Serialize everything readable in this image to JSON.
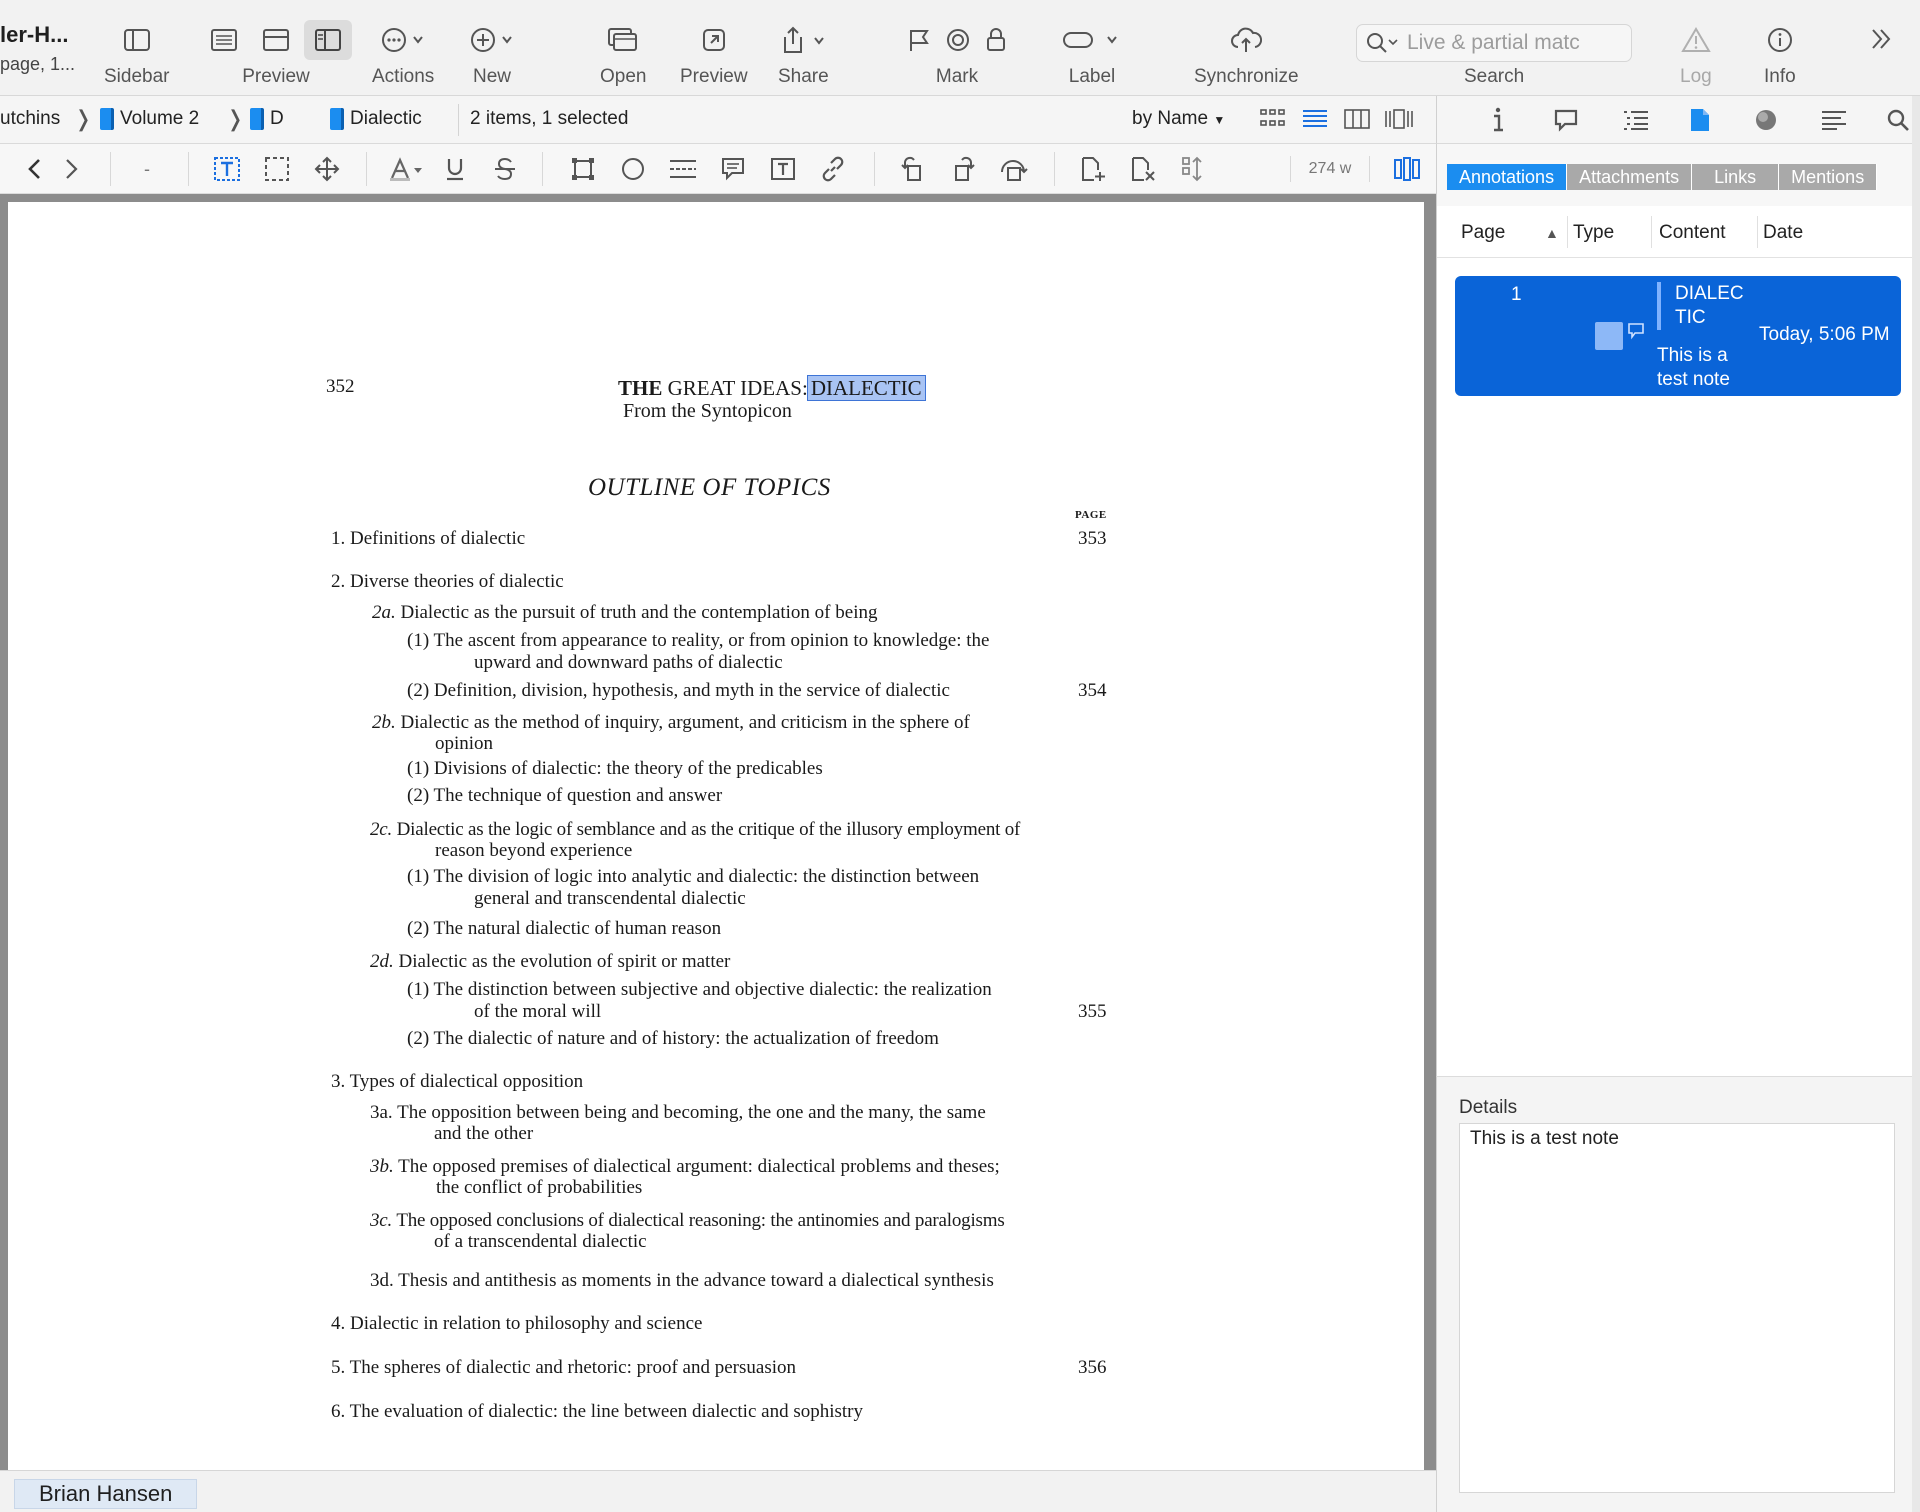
{
  "window": {
    "title": "ler-H...",
    "subtitle": "page, 1..."
  },
  "toolbar": {
    "sidebar": "Sidebar",
    "preview": "Preview",
    "actions": "Actions",
    "new": "New",
    "open": "Open",
    "preview2": "Preview",
    "share": "Share",
    "mark": "Mark",
    "label": "Label",
    "synchronize": "Synchronize",
    "search": "Search",
    "search_placeholder": "Live & partial matc",
    "log": "Log",
    "info": "Info"
  },
  "pathbar": {
    "crumbs": [
      "utchins",
      "Volume 2",
      "D"
    ],
    "current_group": "Dialectic",
    "status": "2 items, 1 selected",
    "sort": "by Name"
  },
  "edit_toolbar": {
    "zoom_hint": "-",
    "word_count": "274 w"
  },
  "inspector": {
    "tabs": [
      "Annotations",
      "Attachments",
      "Links",
      "Mentions"
    ],
    "active_tab": "Annotations",
    "columns": [
      "Page",
      "Type",
      "Content",
      "Date"
    ],
    "rows": [
      {
        "page": "1",
        "content_highlight": "DIALECTIC",
        "content_note": "This is a test note",
        "date": "Today, 5:06 PM"
      }
    ],
    "details_label": "Details",
    "details_text": "This is a test note"
  },
  "document": {
    "page_number": "352",
    "title_bold": "THE",
    "title_rest": "GREAT IDEAS:",
    "title_highlight": "DIALECTIC",
    "subtitle": "From the Syntopicon",
    "outline_heading": "OUTLINE OF TOPICS",
    "page_column_label": "PAGE",
    "topics": {
      "t1": "1. Definitions of dialectic",
      "t2": "2. Diverse theories of dialectic",
      "t2a_num": "2a.",
      "t2a": "Dialectic as the pursuit of truth and the contemplation of being",
      "t2a1a": "(1) The ascent from appearance to reality, or from opinion to knowledge: the",
      "t2a1b": "upward and downward paths of dialectic",
      "t2a2": "(2) Definition, division, hypothesis, and myth in the service of dialectic",
      "t2b_num": "2b.",
      "t2b_a": "Dialectic as the method of inquiry, argument, and criticism in the sphere of",
      "t2b_b": "opinion",
      "t2b1": "(1) Divisions of dialectic: the theory of the predicables",
      "t2b2": "(2) The technique of question and answer",
      "t2c_num": "2c.",
      "t2c_a": "Dialectic as the logic of semblance and as the critique of the illusory employment of",
      "t2c_b": "reason beyond experience",
      "t2c1a": "(1) The division of logic into analytic and dialectic: the distinction between",
      "t2c1b": "general and transcendental dialectic",
      "t2c2": "(2) The natural dialectic of human reason",
      "t2d_num": "2d.",
      "t2d": "Dialectic as the evolution of spirit or matter",
      "t2d1a": "(1) The distinction between subjective and objective dialectic: the realization",
      "t2d1b": "of the moral will",
      "t2d2": "(2) The dialectic of nature and of history: the actualization of freedom",
      "t3": "3. Types of dialectical opposition",
      "t3a_a": "3a. The opposition between being and becoming, the one and the many, the same",
      "t3a_b": "and the other",
      "t3b_num": "3b.",
      "t3b_a": "The opposed premises of dialectical argument: dialectical problems and theses;",
      "t3b_b": "the conflict of probabilities",
      "t3c_num": "3c.",
      "t3c_a": "The opposed conclusions of dialectical reasoning: the antinomies and paralogisms",
      "t3c_b": "of a transcendental dialectic",
      "t3d": "3d. Thesis and antithesis as moments in the advance toward a dialectical synthesis",
      "t4": "4. Dialectic in relation to philosophy and science",
      "t5": "5. The spheres of dialectic and rhetoric: proof and persuasion",
      "t6": "6. The evaluation of dialectic: the line between dialectic and sophistry"
    },
    "page_refs": {
      "p353": "353",
      "p354": "354",
      "p355": "355",
      "p356": "356"
    }
  },
  "footer": {
    "user": "Brian Hansen"
  },
  "colors": {
    "accent": "#1b8df0",
    "selection": "#0a64d8",
    "highlight": "#a9c4f4"
  }
}
